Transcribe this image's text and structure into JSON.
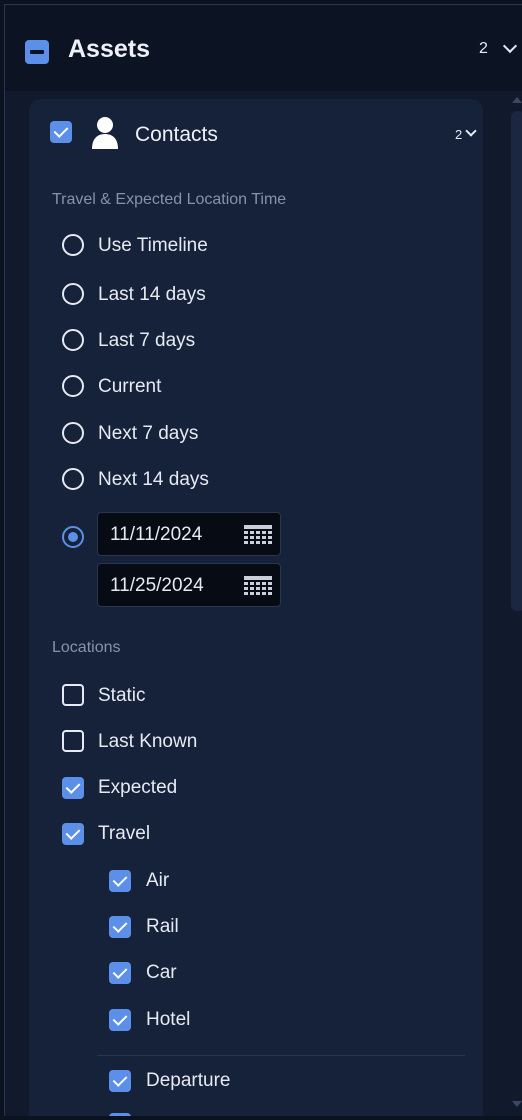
{
  "assets": {
    "title": "Assets",
    "count": "2"
  },
  "contacts": {
    "title": "Contacts",
    "count": "2",
    "checked": true
  },
  "travel_section": {
    "title": "Travel & Expected Location Time",
    "options": [
      {
        "label": "Use Timeline",
        "selected": false
      },
      {
        "label": "Last 14 days",
        "selected": false
      },
      {
        "label": "Last 7 days",
        "selected": false
      },
      {
        "label": "Current",
        "selected": false
      },
      {
        "label": "Next 7 days",
        "selected": false
      },
      {
        "label": "Next 14 days",
        "selected": false
      }
    ],
    "custom_range": {
      "selected": true,
      "start_date": "11/11/2024",
      "end_date": "11/25/2024"
    }
  },
  "locations_section": {
    "title": "Locations",
    "items": [
      {
        "label": "Static",
        "checked": false
      },
      {
        "label": "Last Known",
        "checked": false
      },
      {
        "label": "Expected",
        "checked": true
      },
      {
        "label": "Travel",
        "checked": true
      }
    ],
    "travel_subitems": [
      {
        "label": "Air",
        "checked": true
      },
      {
        "label": "Rail",
        "checked": true
      },
      {
        "label": "Car",
        "checked": true
      },
      {
        "label": "Hotel",
        "checked": true
      }
    ],
    "departure": {
      "label": "Departure",
      "checked": true
    }
  },
  "colors": {
    "accent": "#5b8fe8",
    "background": "#0b1220",
    "card": "#16223a"
  }
}
